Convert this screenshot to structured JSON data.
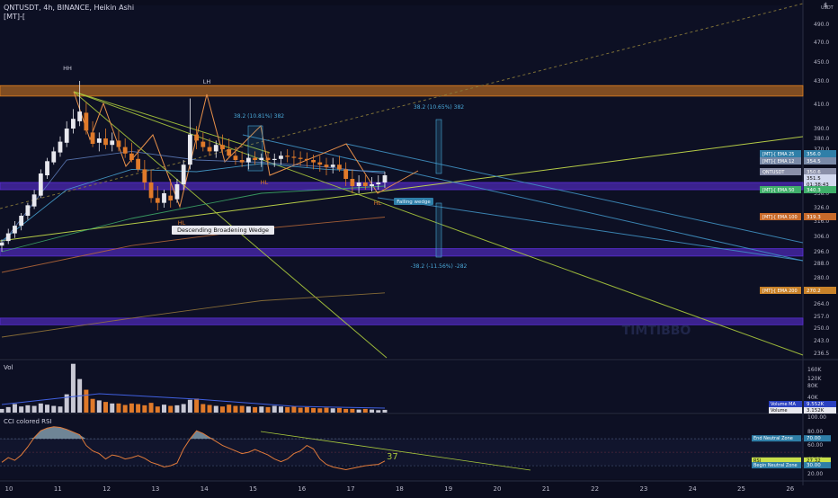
{
  "header": {
    "title": "QNTUSDT, 4h, BINANCE, Heikin Ashi",
    "indicator": "[MT]-[",
    "top_right": "$"
  },
  "watermark": "TIMTIBBO",
  "chart_data": [
    {
      "type": "candlestick",
      "name": "QNTUSDT, 4h, BINANCE, Heikin Ashi",
      "y_unit": "USDT",
      "ylim": [
        236.5,
        497
      ],
      "yticks": [
        490.0,
        470.0,
        450.0,
        430.0,
        410.0,
        390.0,
        380.0,
        370.0,
        360.0,
        350.0,
        338.0,
        326.0,
        316.0,
        306.0,
        296.0,
        288.0,
        280.0,
        272.0,
        264.0,
        257.0,
        250.0,
        243.0,
        236.5
      ],
      "xticks": [
        "10",
        "11",
        "12",
        "13",
        "14",
        "15",
        "16",
        "17",
        "18",
        "19",
        "20",
        "21",
        "22",
        "23",
        "24",
        "25",
        "26"
      ],
      "candles": [
        {
          "o": 300.0,
          "h": 304.0,
          "l": 296.0,
          "c": 302.0
        },
        {
          "o": 303.0,
          "h": 311.0,
          "l": 301.0,
          "c": 308.0
        },
        {
          "o": 308.0,
          "h": 316.0,
          "l": 305.0,
          "c": 313.0
        },
        {
          "o": 313.0,
          "h": 322.0,
          "l": 310.0,
          "c": 320.0
        },
        {
          "o": 320.0,
          "h": 330.0,
          "l": 317.0,
          "c": 328.0
        },
        {
          "o": 327.0,
          "h": 340.0,
          "l": 325.0,
          "c": 337.0
        },
        {
          "o": 336.0,
          "h": 352.0,
          "l": 334.0,
          "c": 349.0
        },
        {
          "o": 348.0,
          "h": 362.0,
          "l": 346.0,
          "c": 359.0
        },
        {
          "o": 358.0,
          "h": 372.0,
          "l": 356.0,
          "c": 368.0
        },
        {
          "o": 367.0,
          "h": 382.0,
          "l": 363.0,
          "c": 377.0
        },
        {
          "o": 376.0,
          "h": 396.0,
          "l": 372.0,
          "c": 390.0
        },
        {
          "o": 390.0,
          "h": 406.0,
          "l": 385.0,
          "c": 398.0
        },
        {
          "o": 396.0,
          "h": 430.0,
          "l": 392.0,
          "c": 404.0
        },
        {
          "o": 403.0,
          "h": 412.0,
          "l": 384.0,
          "c": 388.0
        },
        {
          "o": 386.0,
          "h": 396.0,
          "l": 372.0,
          "c": 375.0
        },
        {
          "o": 376.0,
          "h": 386.0,
          "l": 368.0,
          "c": 380.0
        },
        {
          "o": 380.0,
          "h": 390.0,
          "l": 370.0,
          "c": 374.0
        },
        {
          "o": 374.0,
          "h": 386.0,
          "l": 368.0,
          "c": 378.0
        },
        {
          "o": 378.0,
          "h": 388.0,
          "l": 368.0,
          "c": 372.0
        },
        {
          "o": 372.0,
          "h": 380.0,
          "l": 362.0,
          "c": 366.0
        },
        {
          "o": 366.0,
          "h": 376.0,
          "l": 358.0,
          "c": 360.0
        },
        {
          "o": 361.0,
          "h": 370.0,
          "l": 350.0,
          "c": 352.0
        },
        {
          "o": 352.0,
          "h": 360.0,
          "l": 340.0,
          "c": 344.0
        },
        {
          "o": 344.0,
          "h": 352.0,
          "l": 330.0,
          "c": 334.0
        },
        {
          "o": 334.0,
          "h": 342.0,
          "l": 324.0,
          "c": 330.0
        },
        {
          "o": 330.0,
          "h": 340.0,
          "l": 326.0,
          "c": 338.0
        },
        {
          "o": 336.0,
          "h": 346.0,
          "l": 326.0,
          "c": 332.0
        },
        {
          "o": 333.0,
          "h": 346.0,
          "l": 330.0,
          "c": 343.0
        },
        {
          "o": 343.0,
          "h": 360.0,
          "l": 340.0,
          "c": 356.0
        },
        {
          "o": 356.0,
          "h": 415.0,
          "l": 352.0,
          "c": 384.0
        },
        {
          "o": 384.0,
          "h": 392.0,
          "l": 370.0,
          "c": 378.0
        },
        {
          "o": 377.0,
          "h": 386.0,
          "l": 368.0,
          "c": 372.0
        },
        {
          "o": 372.0,
          "h": 380.0,
          "l": 364.0,
          "c": 368.0
        },
        {
          "o": 368.0,
          "h": 378.0,
          "l": 362.0,
          "c": 374.0
        },
        {
          "o": 374.0,
          "h": 384.0,
          "l": 366.0,
          "c": 370.0
        },
        {
          "o": 370.0,
          "h": 380.0,
          "l": 362.0,
          "c": 364.0
        },
        {
          "o": 364.0,
          "h": 372.0,
          "l": 356.0,
          "c": 360.0
        },
        {
          "o": 360.0,
          "h": 368.0,
          "l": 354.0,
          "c": 358.0
        },
        {
          "o": 358.0,
          "h": 366.0,
          "l": 352.0,
          "c": 362.0
        },
        {
          "o": 362.0,
          "h": 368.0,
          "l": 356.0,
          "c": 360.0
        },
        {
          "o": 360.0,
          "h": 366.0,
          "l": 354.0,
          "c": 362.0
        },
        {
          "o": 362.0,
          "h": 368.0,
          "l": 356.0,
          "c": 360.0
        },
        {
          "o": 360.0,
          "h": 366.0,
          "l": 354.0,
          "c": 361.0
        },
        {
          "o": 361.0,
          "h": 368.0,
          "l": 356.0,
          "c": 364.0
        },
        {
          "o": 364.0,
          "h": 370.0,
          "l": 358.0,
          "c": 363.0
        },
        {
          "o": 363.0,
          "h": 369.0,
          "l": 356.0,
          "c": 362.0
        },
        {
          "o": 362.0,
          "h": 368.0,
          "l": 355.0,
          "c": 361.0
        },
        {
          "o": 361.0,
          "h": 367.0,
          "l": 354.0,
          "c": 360.0
        },
        {
          "o": 360.0,
          "h": 365.0,
          "l": 352.0,
          "c": 358.0
        },
        {
          "o": 358.0,
          "h": 364.0,
          "l": 350.0,
          "c": 356.0
        },
        {
          "o": 356.0,
          "h": 362.0,
          "l": 348.0,
          "c": 354.0
        },
        {
          "o": 354.0,
          "h": 362.0,
          "l": 349.0,
          "c": 356.0
        },
        {
          "o": 356.0,
          "h": 364.0,
          "l": 350.0,
          "c": 352.0
        },
        {
          "o": 352.0,
          "h": 358.0,
          "l": 342.0,
          "c": 346.0
        },
        {
          "o": 346.0,
          "h": 352.0,
          "l": 338.0,
          "c": 342.0
        },
        {
          "o": 342.0,
          "h": 348.0,
          "l": 338.0,
          "c": 344.0
        },
        {
          "o": 344.0,
          "h": 348.0,
          "l": 340.0,
          "c": 342.0
        },
        {
          "o": 342.0,
          "h": 347.0,
          "l": 339.0,
          "c": 343.0
        },
        {
          "o": 343.0,
          "h": 348.0,
          "l": 340.0,
          "c": 344.0
        },
        {
          "o": 344.0,
          "h": 350.0,
          "l": 341.0,
          "c": 348.0
        }
      ],
      "moving_averages": [
        {
          "name": "[MT]-[ EMA 25",
          "color": "#4aa8d8",
          "values": [
            [
              0,
              303
            ],
            [
              10,
              340
            ],
            [
              20,
              352
            ],
            [
              30,
              350
            ],
            [
              40,
              357
            ],
            [
              50,
              352
            ],
            [
              59,
              350
            ]
          ]
        },
        {
          "name": "[MT]-[ EMA 12",
          "color": "#6080c0",
          "values": [
            [
              0,
              301
            ],
            [
              10,
              360
            ],
            [
              20,
              368
            ],
            [
              30,
              360
            ],
            [
              40,
              358
            ],
            [
              50,
              354
            ],
            [
              59,
              349
            ]
          ]
        },
        {
          "name": "[MT]-[ EMA 50",
          "color": "#3fae6a",
          "values": [
            [
              0,
              296
            ],
            [
              20,
              318
            ],
            [
              40,
              338
            ],
            [
              59,
              342
            ]
          ]
        },
        {
          "name": "[MT]-[ EMA 100",
          "color": "#b86838",
          "values": [
            [
              0,
              283
            ],
            [
              20,
              300
            ],
            [
              40,
              311
            ],
            [
              59,
              319
            ]
          ]
        },
        {
          "name": "[MT]-[ EMA 200",
          "color": "#9a7a3a",
          "values": [
            [
              0,
              245
            ],
            [
              20,
              256
            ],
            [
              40,
              266
            ],
            [
              59,
              271
            ]
          ]
        }
      ],
      "price_labels": [
        {
          "text": "[MT]-[ EMA 25",
          "value": "356.0",
          "color": "#2f7fa8"
        },
        {
          "text": "[MT]-[ EMA 12",
          "value": "354.5",
          "color": "#7a8aa8"
        },
        {
          "text": "QNTUSDT",
          "value": "350.6",
          "color": "#8a8fa8"
        },
        {
          "text": "",
          "value": "351.5",
          "color": "#d2d8ee"
        },
        {
          "text": "",
          "value": "01:38:43",
          "color": "#d2d8ee"
        },
        {
          "text": "[MT]-[ EMA 50",
          "value": "340.3",
          "color": "#3fae6a"
        },
        {
          "text": "[MT]-[ EMA 100",
          "value": "319.3",
          "color": "#c86a2a"
        },
        {
          "text": "[MT]-[ EMA 200",
          "value": "270.2",
          "color": "#c8822a"
        }
      ],
      "zones": [
        {
          "from": 417,
          "to": 426,
          "color": "#e08020"
        },
        {
          "from": 340,
          "to": 344,
          "color": "#5a2fd6"
        },
        {
          "from": 293,
          "to": 298,
          "color": "#5a2fd6"
        },
        {
          "from": 252,
          "to": 256,
          "color": "#5a2fd6"
        }
      ],
      "annotations": [
        {
          "text": "HH",
          "value": 430
        },
        {
          "text": "LH",
          "value": 415
        },
        {
          "text": "HL",
          "value": 321
        },
        {
          "text": "HL",
          "value": 333
        },
        {
          "text": "HL",
          "value": 336
        },
        {
          "text": "Descending Broadening Wedge",
          "value": 306
        },
        {
          "text": "38.2 (10.81%) 382",
          "value": 397
        },
        {
          "text": "38.2 (10.65%) 382",
          "value": 402
        },
        {
          "text": "-38.2 (-11.56%) -282",
          "value": 290
        },
        {
          "text": "Falling wedge",
          "value": 329
        }
      ]
    },
    {
      "type": "bar",
      "name": "Vol",
      "yticks": [
        "160K",
        "120K",
        "80K",
        "40K"
      ],
      "values": [
        12,
        18,
        28,
        20,
        24,
        22,
        30,
        26,
        22,
        20,
        60,
        160,
        110,
        75,
        45,
        40,
        35,
        30,
        30,
        25,
        30,
        28,
        24,
        32,
        20,
        26,
        22,
        24,
        28,
        42,
        46,
        28,
        25,
        22,
        20,
        26,
        22,
        22,
        20,
        18,
        20,
        18,
        22,
        20,
        18,
        20,
        16,
        18,
        15,
        14,
        16,
        14,
        15,
        12,
        12,
        10,
        12,
        10,
        8,
        9
      ],
      "labels": [
        {
          "text": "Volume MA",
          "value": "9.552K"
        },
        {
          "text": "Volume",
          "value": "3.152K"
        }
      ]
    },
    {
      "type": "line",
      "name": "CCI colored RSI",
      "yticks": [
        "100.00",
        "80.00",
        "60.00",
        "40.00",
        "20.00"
      ],
      "values": [
        35,
        42,
        38,
        46,
        58,
        72,
        82,
        86,
        88,
        87,
        84,
        80,
        76,
        60,
        52,
        48,
        40,
        46,
        44,
        40,
        42,
        45,
        41,
        35,
        32,
        28,
        30,
        34,
        55,
        70,
        82,
        78,
        72,
        66,
        60,
        56,
        52,
        48,
        50,
        54,
        50,
        46,
        40,
        36,
        40,
        48,
        52,
        60,
        55,
        40,
        32,
        28,
        26,
        24,
        26,
        28,
        30,
        31,
        32,
        37
      ],
      "last_label": "37",
      "levels": [
        {
          "text": "End Neutral Zone",
          "value": 70,
          "label": "70.00"
        },
        {
          "text": "RSI",
          "value": 37,
          "label": "27.32"
        },
        {
          "text": "Begin Neutral Zone",
          "value": 30,
          "label": "30.00"
        }
      ]
    }
  ]
}
